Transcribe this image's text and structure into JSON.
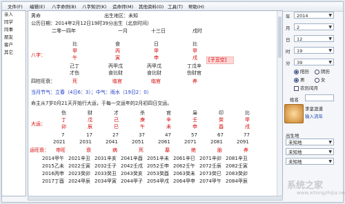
{
  "menu": [
    "文件(F)",
    "编辑(E)",
    "八字命例(B)",
    "八字知识(K)",
    "造命师(M)",
    "其他资料(O)",
    "工具(T)",
    "帮助(H)"
  ],
  "sidebar": [
    "亲人",
    "同学",
    "同事",
    "朋友",
    "客户",
    "其它"
  ],
  "main": {
    "line1": [
      "男命",
      "出生地区：未知"
    ],
    "line2": "公历日期：2014年2月12日19时39分出生（北京时间）",
    "line3": [
      "二零一四年",
      "一月",
      "十三日",
      "戌时"
    ],
    "shishen_top": [
      "比",
      "食",
      "日",
      "比"
    ],
    "bazi_label": "八字：",
    "tiangan": [
      "甲",
      "丙",
      "甲",
      "甲"
    ],
    "dizhi": [
      "午",
      "寅",
      "申",
      "戌"
    ],
    "kongwang": "[子丑空]",
    "canggan": [
      "己丁",
      "丙甲戊",
      "丙甲戊",
      "丁戊辛"
    ],
    "canggan_shishen": [
      "才伤",
      "食比财",
      "食比财",
      "伤财官"
    ],
    "sizhu_label": "四柱旺衰：",
    "sizhu_vals": [
      "死",
      "临官",
      "临官",
      "养"
    ],
    "jieqi": "当月节气：立春（4日6：3）；中气：雨水（19日2：0）",
    "qiyun": "命主从7岁0月21天开始行大运，于每一交运年的2月初四日交运。",
    "dayun_shishen": [
      "伤",
      "财",
      "才",
      "杀",
      "官",
      "枭",
      "印",
      "比"
    ],
    "dayun_label": "大运：",
    "dayun_gan": [
      "丁",
      "戊",
      "己",
      "庚",
      "辛",
      "壬",
      "癸",
      "甲"
    ],
    "dayun_zhi": [
      "卯",
      "辰",
      "巳",
      "午",
      "未",
      "申",
      "酉",
      "戌"
    ],
    "dayun_ages": [
      "7",
      "17",
      "27",
      "37",
      "47",
      "57",
      "67",
      "77"
    ],
    "dayun_years": [
      "2021",
      "2031",
      "2041",
      "2051",
      "2061",
      "2071",
      "2081",
      "2091"
    ],
    "yunwang_label": "运旺衰：",
    "yunwang": [
      "帝旺",
      "衰",
      "病",
      "死",
      "墓",
      "绝",
      "胎",
      "养"
    ],
    "liunian": [
      [
        "2014甲午",
        "2021辛丑",
        "2031辛亥",
        "2041辛酉",
        "2051辛未",
        "2061辛巳",
        "2071辛卯",
        "2081辛丑"
      ],
      [
        "2015乙未",
        "2022壬寅",
        "2032壬子",
        "2042壬戌",
        "2052壬申",
        "2062壬午",
        "2072壬辰",
        "2082壬寅"
      ],
      [
        "2016丙申",
        "2023癸卯",
        "2033癸丑",
        "2043癸亥",
        "2053癸酉",
        "2063癸未",
        "2073癸巳",
        "2083癸卯"
      ],
      [
        "2017丁酉",
        "2024甲辰",
        "2034甲寅",
        "2044甲子",
        "2054甲戌",
        "2064甲申",
        "2074甲午",
        "2084甲辰"
      ]
    ]
  },
  "right": {
    "year_label": "年",
    "year_val": "2014",
    "month_label": "月",
    "month_val": "2",
    "day_label": "日",
    "day_val": "12",
    "hour_label": "时",
    "hour_val": "19",
    "min_label": "分",
    "min_val": "39",
    "solar": "阳历",
    "lunar": "阴历",
    "male": "男",
    "female": "女",
    "leap": "农历闰月",
    "name_label": "姓名",
    "nick": "李皇涯道",
    "enter": "输入流年",
    "place_label": "出生地",
    "place_val1": "未知地",
    "place_val2": "未知地",
    "place_val3": "未知地"
  },
  "watermark": "系统之家",
  "watermark_sub": "www.xitongzhijia.net",
  "colors": {
    "accent_red": "#d40000",
    "accent_blue": "#1e3cc8"
  }
}
